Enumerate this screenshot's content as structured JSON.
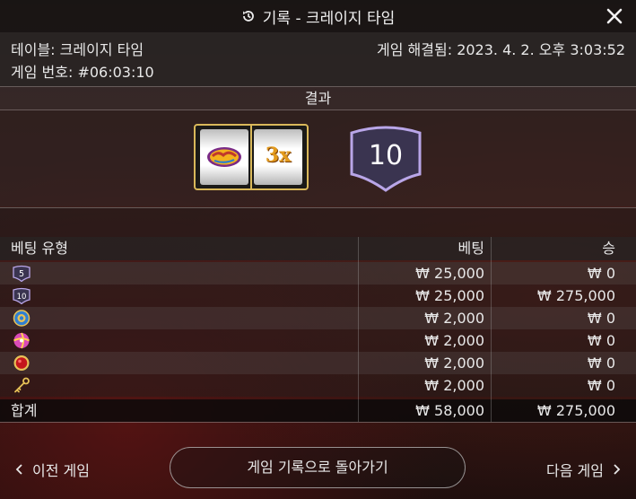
{
  "window": {
    "title": "기록 - 크레이지 타임",
    "title_icon": "history-icon",
    "close_icon": "close-icon"
  },
  "info": {
    "table_label": "테이블: 크레이지 타임",
    "game_number_label": "게임 번호: #06:03:10",
    "resolved_label": "게임 해결됨: 2023. 4. 2. 오후 3:03:52"
  },
  "result": {
    "label": "결과",
    "slot_left_icon": "crazy-time-logo-icon",
    "slot_multiplier": "3x",
    "wheel_result": "10"
  },
  "table": {
    "headers": {
      "bet_type": "베팅 유형",
      "bet": "베팅",
      "win": "승"
    },
    "rows": [
      {
        "icon": "number-5-icon",
        "icon_text": "5",
        "bet": "₩ 25,000",
        "win": "₩ 0"
      },
      {
        "icon": "number-10-icon",
        "icon_text": "10",
        "bet": "₩ 25,000",
        "win": "₩ 275,000"
      },
      {
        "icon": "coin-flip-icon",
        "bet": "₩ 2,000",
        "win": "₩ 0"
      },
      {
        "icon": "pachinko-icon",
        "bet": "₩ 2,000",
        "win": "₩ 0"
      },
      {
        "icon": "cash-hunt-icon",
        "bet": "₩ 2,000",
        "win": "₩ 0"
      },
      {
        "icon": "key-icon",
        "bet": "₩ 2,000",
        "win": "₩ 0"
      }
    ],
    "total": {
      "label": "합계",
      "bet": "₩ 58,000",
      "win": "₩ 275,000"
    }
  },
  "footer": {
    "prev_label": "이전 게임",
    "back_label": "게임 기록으로 돌아가기",
    "next_label": "다음 게임"
  },
  "colors": {
    "gold": "#d9b85a",
    "badge_purple": "#b9a6e8",
    "badge_dark": "#3a3450"
  }
}
